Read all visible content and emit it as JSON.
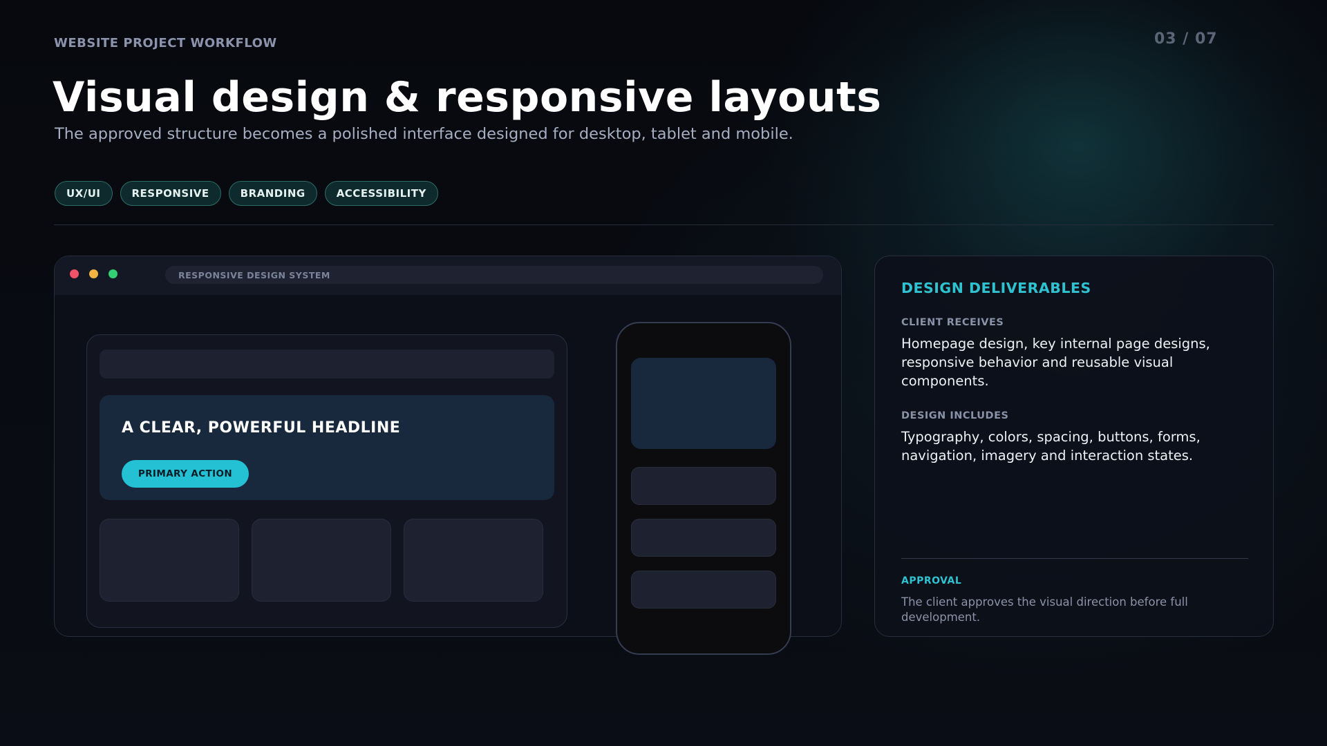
{
  "header": {
    "eyebrow": "WEBSITE PROJECT WORKFLOW",
    "page_indicator": "03 / 07",
    "title": "Visual design & responsive layouts",
    "subtitle": "The approved structure becomes a polished interface designed for desktop, tablet and mobile."
  },
  "tags": [
    "UX/UI",
    "RESPONSIVE",
    "BRANDING",
    "ACCESSIBILITY"
  ],
  "mockup": {
    "url_bar_text": "RESPONSIVE DESIGN SYSTEM",
    "window_controls": [
      "close-dot",
      "minimize-dot",
      "maximize-dot"
    ],
    "hero_headline": "A CLEAR, POWERFUL HEADLINE",
    "primary_button": "PRIMARY ACTION"
  },
  "panel": {
    "title": "DESIGN DELIVERABLES",
    "client_receives_label": "CLIENT RECEIVES",
    "client_receives_text": "Homepage design, key internal page designs, responsive behavior and reusable visual components.",
    "design_includes_label": "DESIGN INCLUDES",
    "design_includes_text": "Typography, colors, spacing, buttons, forms, navigation, imagery and interaction states.",
    "approval_label": "APPROVAL",
    "approval_text": "The client approves the visual direction before full development."
  },
  "colors": {
    "accent": "#2fc2d0",
    "button": "#24c0d4",
    "tag_border": "#2b6e6a",
    "close_dot": "#f0526a",
    "minimize_dot": "#f3b342",
    "maximize_dot": "#34cf72"
  }
}
